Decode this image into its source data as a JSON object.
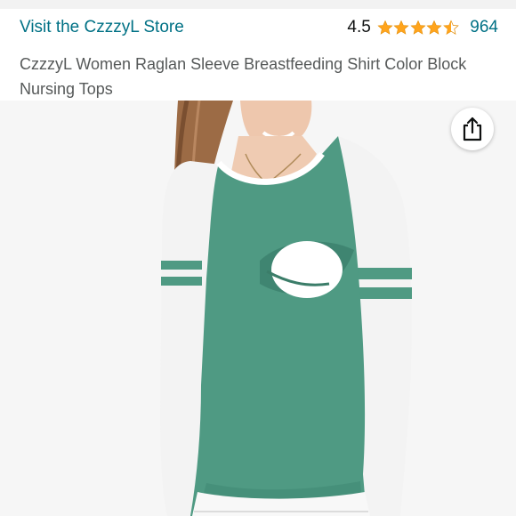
{
  "header": {
    "store_link": "Visit the CzzzyL Store",
    "rating_value": "4.5",
    "rating_stars": 4.5,
    "rating_count": "964"
  },
  "product": {
    "title": "CzzzyL Women Raglan Sleeve Breastfeeding Shirt Color Block Nursing Tops"
  },
  "icons": {
    "share": "share-icon",
    "star": "star-icon"
  },
  "colors": {
    "link": "#007185",
    "star": "#FFA41C",
    "shirt_green": "#4f9a83",
    "sleeve_white": "#f4f4f4"
  }
}
